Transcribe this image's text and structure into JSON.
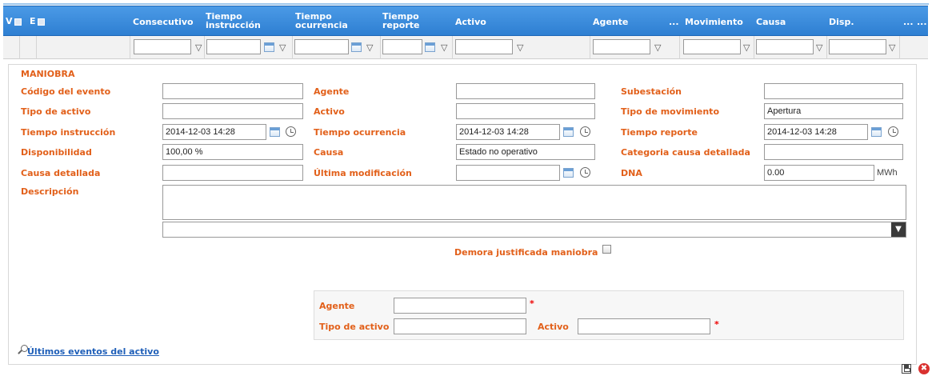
{
  "grid": {
    "header": {
      "v": "V",
      "e": "E",
      "consecutivo": "Consecutivo",
      "tiempo_instruccion": "Tiempo instrucción",
      "tiempo_ocurrencia": "Tiempo ocurrencia",
      "tiempo_reporte": "Tiempo reporte",
      "activo": "Activo",
      "agente": "Agente",
      "ellipsis1": "...",
      "movimiento": "Movimiento",
      "causa": "Causa",
      "disp": "Disp.",
      "ellipsis2": "...",
      "ellipsis3": "..."
    }
  },
  "form": {
    "section_title": "MANIOBRA",
    "codigo_evento": {
      "label": "Código del evento",
      "value": ""
    },
    "agente": {
      "label": "Agente",
      "value": ""
    },
    "subestacion": {
      "label": "Subestación",
      "value": ""
    },
    "tipo_activo": {
      "label": "Tipo de activo",
      "value": ""
    },
    "activo": {
      "label": "Activo",
      "value": ""
    },
    "tipo_movimiento": {
      "label": "Tipo de movimiento",
      "value": "Apertura"
    },
    "tiempo_instruccion": {
      "label": "Tiempo instrucción",
      "value": "2014-12-03 14:28"
    },
    "tiempo_ocurrencia": {
      "label": "Tiempo ocurrencia",
      "value": "2014-12-03 14:28"
    },
    "tiempo_reporte": {
      "label": "Tiempo reporte",
      "value": "2014-12-03 14:28"
    },
    "disponibilidad": {
      "label": "Disponibilidad",
      "value": "100,00 %"
    },
    "causa": {
      "label": "Causa",
      "value": "Estado no operativo"
    },
    "categoria_causa": {
      "label": "Categoria causa detallada",
      "value": ""
    },
    "causa_detallada": {
      "label": "Causa detallada",
      "value": ""
    },
    "ultima_modificacion": {
      "label": "Última modificación",
      "value": ""
    },
    "dna": {
      "label": "DNA",
      "value": "0.00",
      "unit": "MWh"
    },
    "descripcion": {
      "label": "Descripción",
      "value": ""
    },
    "demora": {
      "label": "Demora justificada maniobra"
    },
    "sub": {
      "agente_label": "Agente",
      "tipo_activo_label": "Tipo de activo",
      "activo_label": "Activo",
      "required_mark": "*"
    },
    "ultimos_eventos_link": "Últimos eventos del activo"
  },
  "colors": {
    "label": "#e2601a",
    "header": "#2e7fd2",
    "link": "#1f5fb8"
  }
}
